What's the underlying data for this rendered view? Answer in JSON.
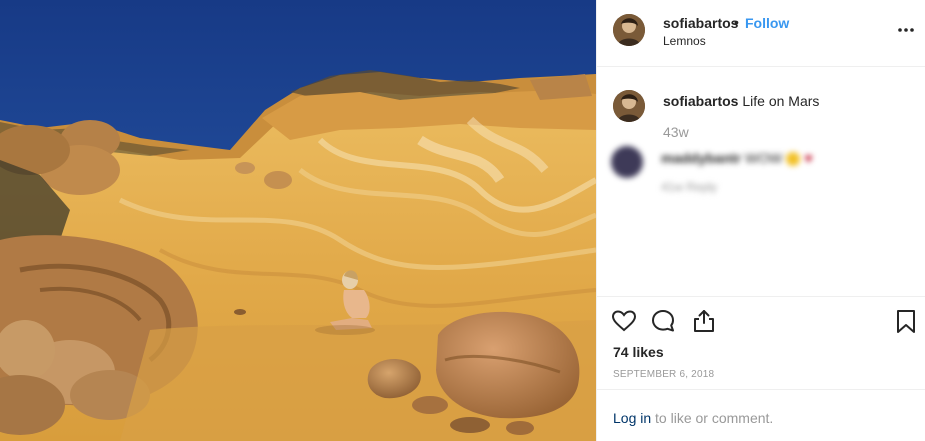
{
  "post": {
    "image": {
      "alt": "Child sitting among sandstone rock formations"
    },
    "header": {
      "username": "sofiabartos",
      "separator": "•",
      "follow_label": "Follow",
      "location": "Lemnos",
      "more_icon": "more-horizontal-icon"
    },
    "caption": {
      "username": "sofiabartos",
      "text": " Life on Mars",
      "time_ago": "43w"
    },
    "comment": {
      "blurred": true,
      "username": "maddybantr",
      "text": "WOW",
      "meta": "41w   Reply"
    },
    "actions": {
      "like_icon": "heart-icon",
      "comment_icon": "comment-icon",
      "share_icon": "share-icon",
      "save_icon": "bookmark-icon"
    },
    "likes": "74 likes",
    "date": "SEPTEMBER 6, 2018",
    "login": {
      "link_label": "Log in",
      "rest": " to like or comment."
    }
  },
  "colors": {
    "link_blue": "#3897f0",
    "login_link": "#003569",
    "muted_text": "#999999",
    "text": "#262626",
    "border": "#efefef",
    "sky": "#1e3e8a",
    "sand": "#e6b04a"
  }
}
